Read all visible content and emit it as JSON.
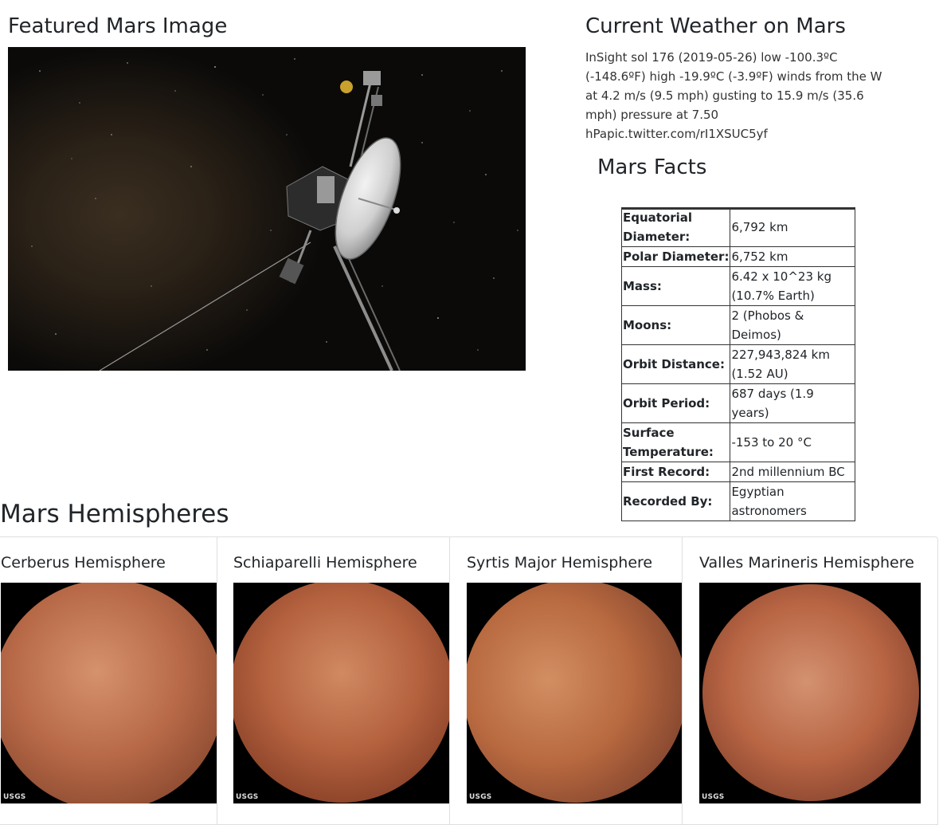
{
  "featured": {
    "heading": "Featured Mars Image"
  },
  "weather": {
    "heading": "Current Weather on Mars",
    "text": "InSight sol 176 (2019-05-26) low -100.3ºC (-148.6ºF) high -19.9ºC (-3.9ºF) winds from the W at 4.2 m/s (9.5 mph) gusting to 15.9 m/s (35.6 mph) pressure at 7.50 hPapic.twitter.com/rI1XSUC5yf"
  },
  "facts": {
    "heading": "Mars Facts",
    "rows": [
      {
        "label": "Equatorial Diameter:",
        "value": "6,792 km"
      },
      {
        "label": "Polar Diameter:",
        "value": "6,752 km"
      },
      {
        "label": "Mass:",
        "value": "6.42 x 10^23 kg (10.7% Earth)"
      },
      {
        "label": "Moons:",
        "value": "2 (Phobos & Deimos)"
      },
      {
        "label": "Orbit Distance:",
        "value": "227,943,824 km (1.52 AU)"
      },
      {
        "label": "Orbit Period:",
        "value": "687 days (1.9 years)"
      },
      {
        "label": "Surface Temperature:",
        "value": "-153 to 20 °C"
      },
      {
        "label": "First Record:",
        "value": "2nd millennium BC"
      },
      {
        "label": "Recorded By:",
        "value": "Egyptian astronomers"
      }
    ]
  },
  "hemispheres": {
    "heading": "Mars Hemispheres",
    "cards": [
      {
        "title": "Cerberus Hemisphere",
        "logo": "USGS",
        "color": "#b86a48"
      },
      {
        "title": "Schiaparelli Hemisphere",
        "logo": "USGS",
        "color": "#b5623f"
      },
      {
        "title": "Syrtis Major Hemisphere",
        "logo": "USGS",
        "color": "#b8693f"
      },
      {
        "title": "Valles Marineris Hemisphere",
        "logo": "USGS",
        "color": "#b86543"
      }
    ]
  }
}
